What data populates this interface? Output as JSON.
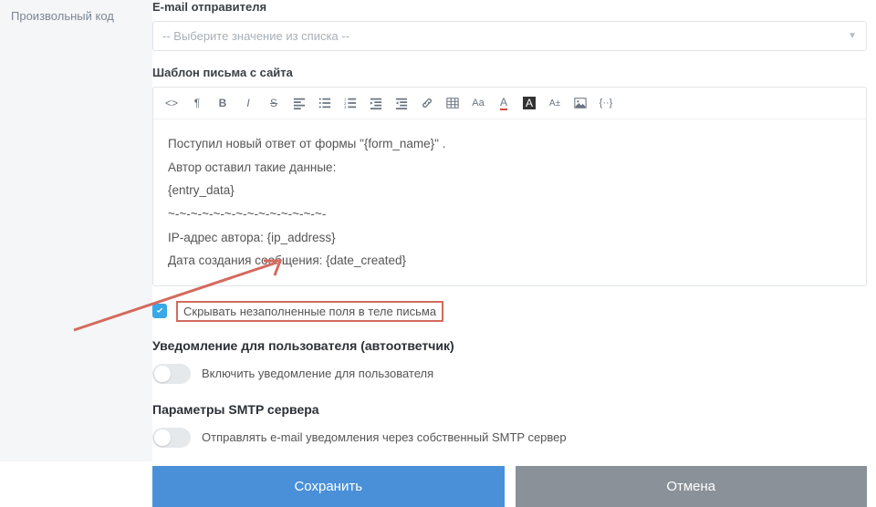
{
  "sidebar": {
    "item": "Произвольный код"
  },
  "emailSender": {
    "label": "E-mail отправителя",
    "placeholder": "-- Выберите значение из списка --"
  },
  "template": {
    "label": "Шаблон письма с сайта",
    "lines": {
      "l0": "Поступил новый ответ от формы \"{form_name}\" .",
      "l1": "Автор оставил такие данные:",
      "l2": "{entry_data}",
      "l3": "~-~-~-~-~-~-~-~-~-~-~-~-~-~-",
      "l4": "IP-адрес автора: {ip_address}",
      "l5": "Дата создания сообщения: {date_created}"
    }
  },
  "hideEmpty": {
    "checked": true,
    "label": "Скрывать незаполненные поля в теле письма"
  },
  "autoReply": {
    "title": "Уведомление для пользователя (автоответчик)",
    "toggleLabel": "Включить уведомление для пользователя"
  },
  "smtp": {
    "title": "Параметры SMTP сервера",
    "toggleLabel": "Отправлять e-mail уведомления через собственный SMTP сервер"
  },
  "buttons": {
    "save": "Сохранить",
    "cancel": "Отмена"
  }
}
